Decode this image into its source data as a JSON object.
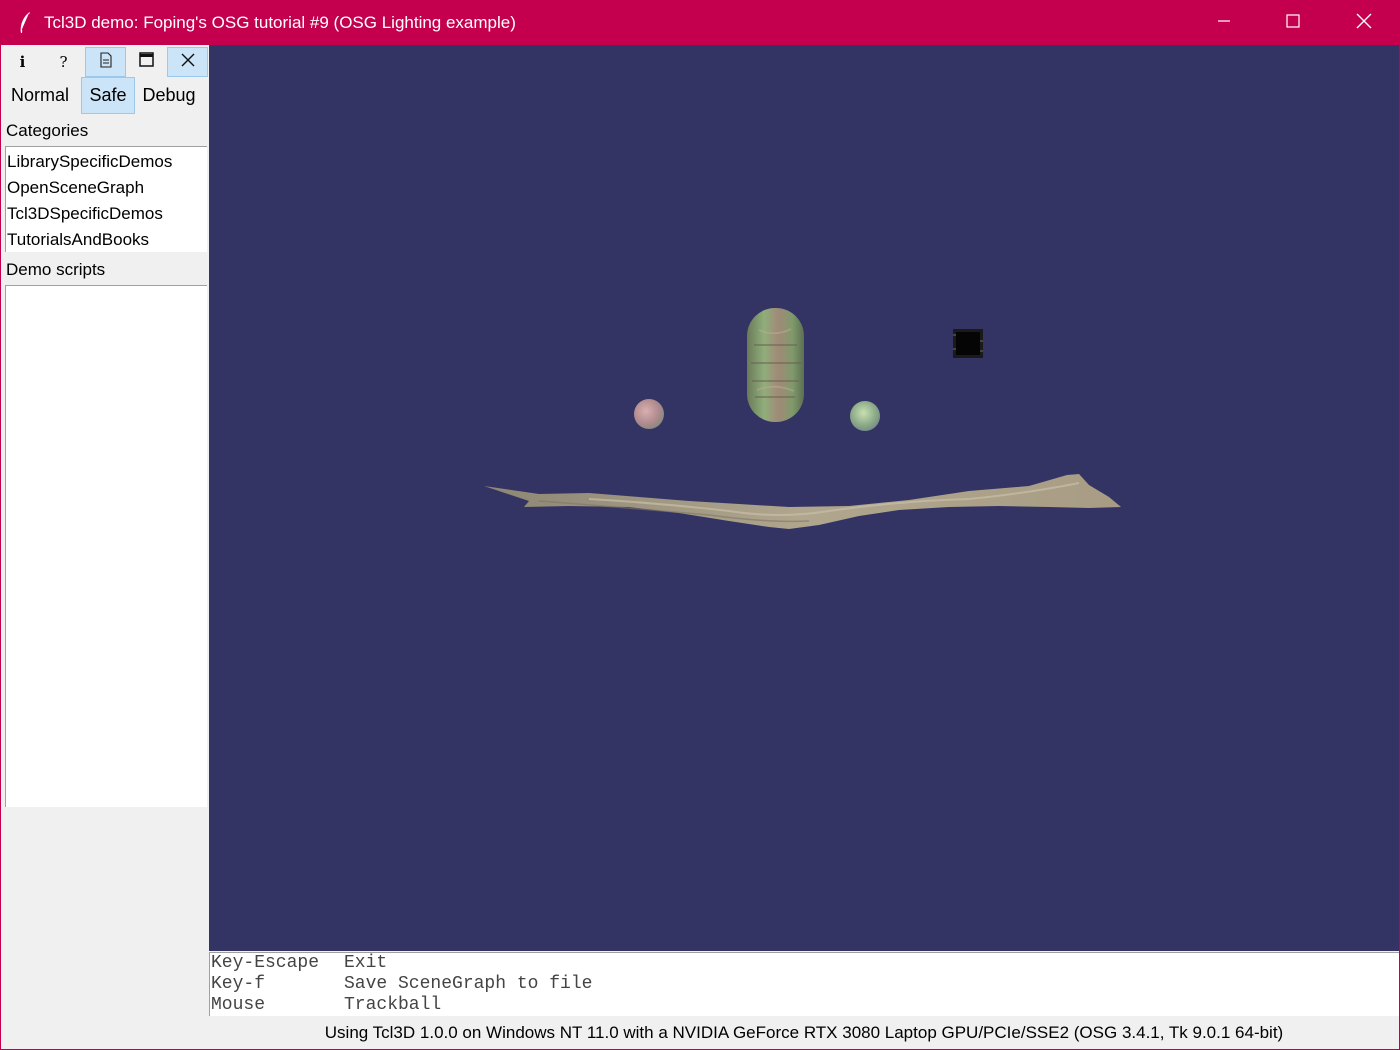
{
  "window": {
    "title": "Tcl3D demo: Foping's OSG tutorial #9 (OSG Lighting example)",
    "accent_color": "#c4004e",
    "controls": [
      "minimize-icon",
      "maximize-icon",
      "close-icon"
    ]
  },
  "toolbar": {
    "buttons": [
      {
        "icon": "info-icon",
        "glyph": "i"
      },
      {
        "icon": "help-icon",
        "glyph": "?"
      },
      {
        "icon": "document-icon",
        "glyph": ""
      },
      {
        "icon": "maximize-window-icon",
        "glyph": ""
      },
      {
        "icon": "close-icon",
        "glyph": "✕"
      }
    ]
  },
  "modes": {
    "normal": "Normal",
    "safe": "Safe",
    "debug": "Debug",
    "selected": "Safe"
  },
  "categories": {
    "label": "Categories",
    "items": [
      "LibrarySpecificDemos",
      "OpenSceneGraph",
      "Tcl3DSpecificDemos",
      "TutorialsAndBooks"
    ]
  },
  "demo_scripts": {
    "label": "Demo scripts",
    "items": []
  },
  "viewport": {
    "background_color": "#343464"
  },
  "help": {
    "rows": [
      {
        "key": "Key-Escape",
        "action": "Exit"
      },
      {
        "key": "Key-f",
        "action": "Save SceneGraph to file"
      },
      {
        "key": "Mouse",
        "action": "Trackball"
      }
    ]
  },
  "status": {
    "text": "Using Tcl3D 1.0.0 on Windows NT 11.0 with a NVIDIA GeForce RTX 3080 Laptop GPU/PCIe/SSE2 (OSG 3.4.1, Tk 9.0.1 64-bit)"
  }
}
